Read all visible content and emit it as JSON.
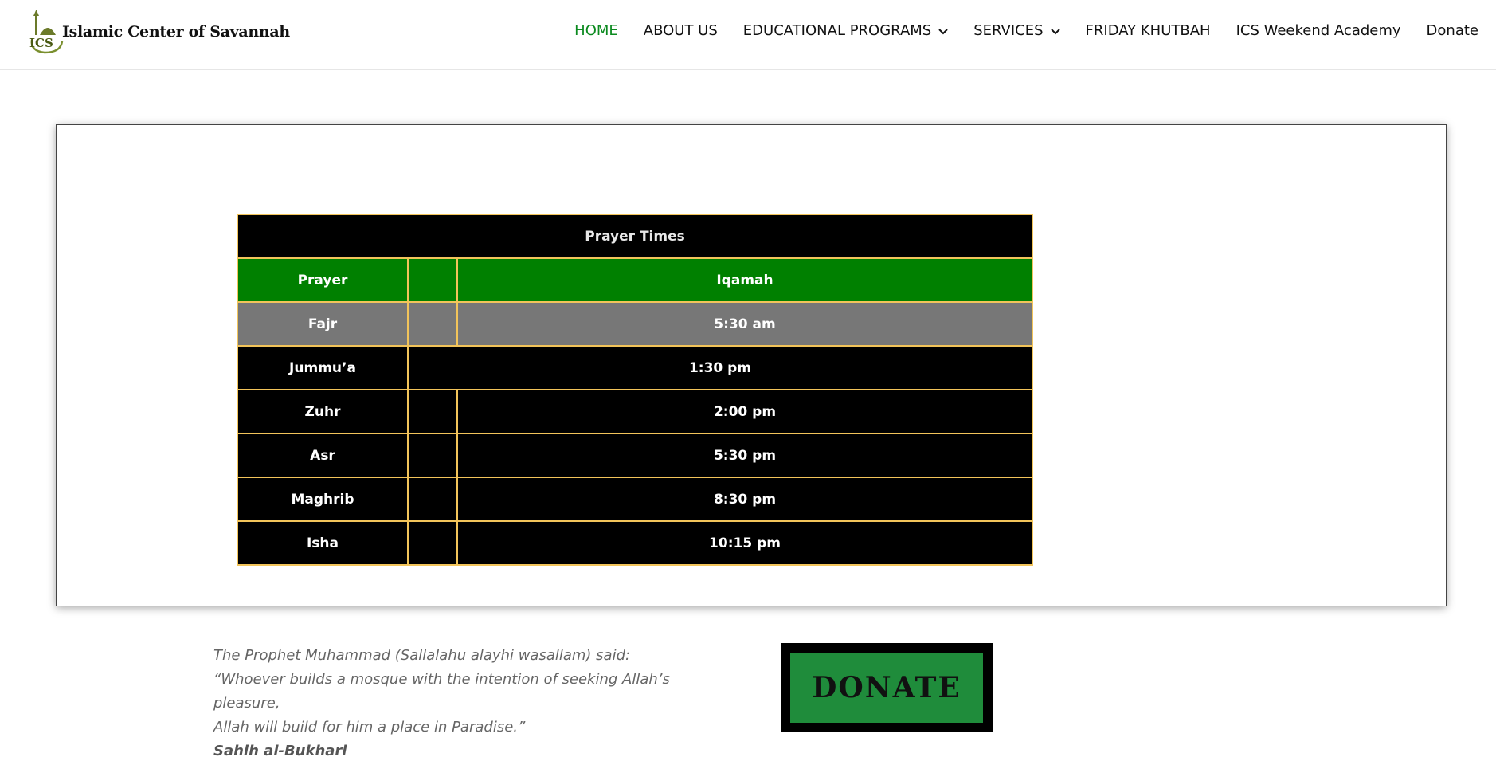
{
  "brand": {
    "logo_initials": "ICS",
    "name": "Islamic Center of Savannah"
  },
  "nav": {
    "items": [
      {
        "label": "HOME",
        "active": true,
        "dropdown": false
      },
      {
        "label": "ABOUT US",
        "active": false,
        "dropdown": false
      },
      {
        "label": "EDUCATIONAL PROGRAMS",
        "active": false,
        "dropdown": true
      },
      {
        "label": "SERVICES",
        "active": false,
        "dropdown": true
      },
      {
        "label": "FRIDAY KHUTBAH",
        "active": false,
        "dropdown": false
      },
      {
        "label": "ICS Weekend Academy",
        "active": false,
        "dropdown": false
      },
      {
        "label": "Donate",
        "active": false,
        "dropdown": false
      }
    ]
  },
  "prayer_table": {
    "title": "Prayer Times",
    "headers": {
      "prayer": "Prayer",
      "middle": "",
      "iqamah": "Iqamah"
    },
    "rows": [
      {
        "prayer": "Fajr",
        "iqamah": "5:30 am"
      },
      {
        "prayer": "Jummu’a",
        "iqamah": "1:30  pm"
      },
      {
        "prayer": "Zuhr",
        "iqamah": "2:00 pm"
      },
      {
        "prayer": "Asr",
        "iqamah": "5:30 pm"
      },
      {
        "prayer": "Maghrib",
        "iqamah": "8:30 pm"
      },
      {
        "prayer": "Isha",
        "iqamah": "10:15 pm"
      }
    ]
  },
  "quote": {
    "line1": "The Prophet Muhammad (Sallalahu alayhi wasallam) said:",
    "line2": "“Whoever builds a mosque with the intention of seeking Allah’s pleasure,",
    "line3": "Allah will build for him a place in Paradise.”",
    "source": "Sahih al-Bukhari"
  },
  "donate_button": {
    "label": "DONATE"
  },
  "colors": {
    "accent_green": "#0b8a1f",
    "table_header_green": "#008000",
    "table_border_gold": "#f2c45a",
    "fajr_row_gray": "#777777",
    "donate_green": "#1f8c3b"
  }
}
